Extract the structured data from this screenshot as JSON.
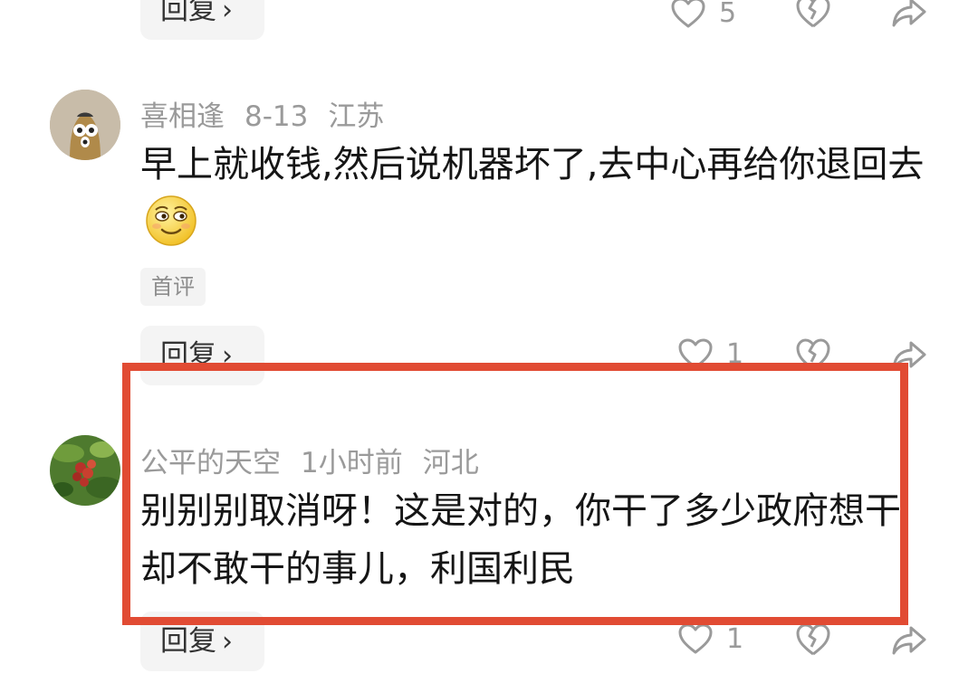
{
  "comments": [
    {
      "reply_label": "回复",
      "like_count": "5"
    },
    {
      "username": "喜相逢",
      "date": "8-13",
      "location": "江苏",
      "text": "早上就收钱,然后说机器坏了,去中心再给你退回去",
      "tag": "首评",
      "reply_label": "回复",
      "like_count": "1",
      "emoji": "smiling-face-emoji"
    },
    {
      "username": "公平的天空",
      "date": "1小时前",
      "location": "河北",
      "text": "别别别取消呀！这是对的，你干了多少政府想干却不敢干的事儿，利国利民",
      "reply_label": "回复",
      "like_count": "1"
    }
  ],
  "icons": {
    "like": "heart-icon",
    "dislike": "broken-heart-icon",
    "share": "share-arrow-icon",
    "reply_chevron": "chevron-right-icon"
  },
  "colors": {
    "highlight_border": "#e14b33",
    "meta_text": "#9a9a9a",
    "reply_bg": "#f4f4f4"
  }
}
